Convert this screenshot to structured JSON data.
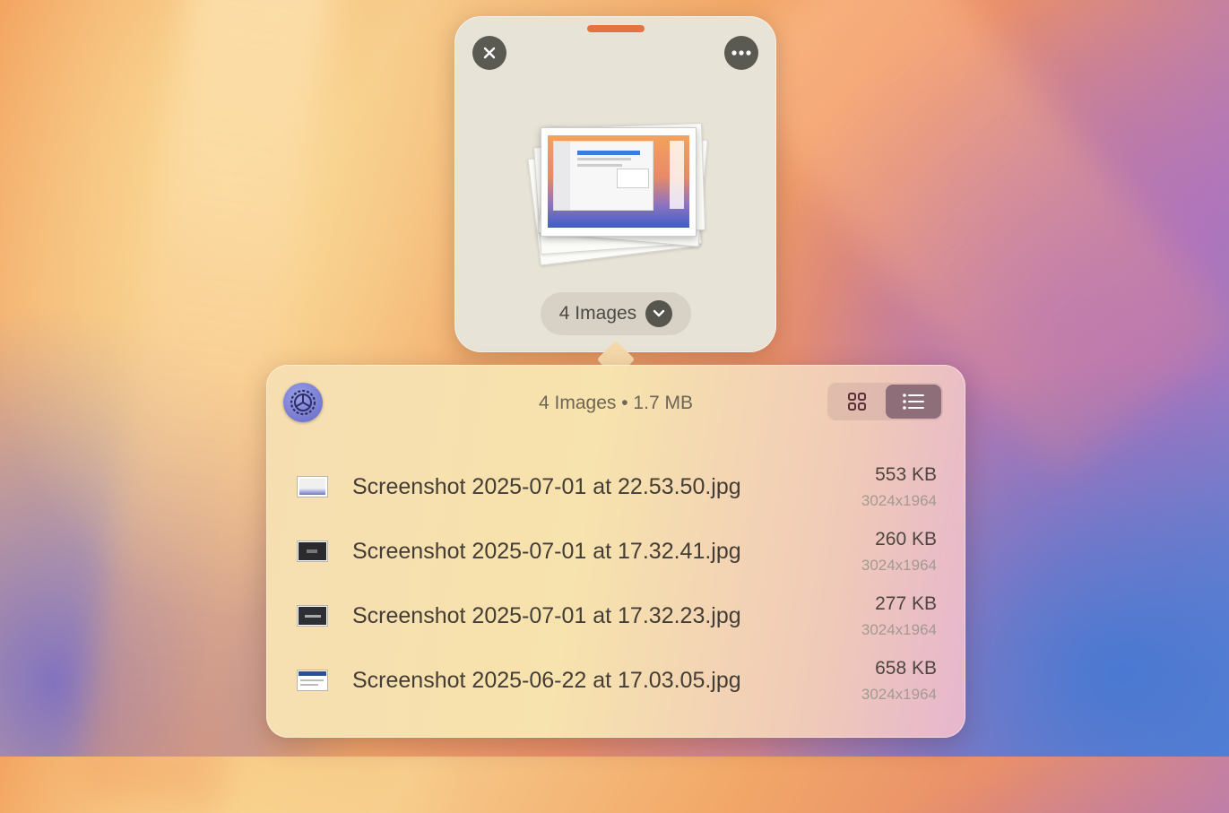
{
  "drop_card": {
    "count_label": "4 Images"
  },
  "panel": {
    "summary": "4 Images • 1.7 MB",
    "files": [
      {
        "name": "Screenshot 2025-07-01 at 22.53.50.jpg",
        "size": "553 KB",
        "dimensions": "3024x1964",
        "thumb_style": "light"
      },
      {
        "name": "Screenshot 2025-07-01 at 17.32.41.jpg",
        "size": "260 KB",
        "dimensions": "3024x1964",
        "thumb_style": "dark"
      },
      {
        "name": "Screenshot 2025-07-01 at 17.32.23.jpg",
        "size": "277 KB",
        "dimensions": "3024x1964",
        "thumb_style": "dark"
      },
      {
        "name": "Screenshot 2025-06-22 at 17.03.05.jpg",
        "size": "658 KB",
        "dimensions": "3024x1964",
        "thumb_style": "document"
      }
    ],
    "view_mode": "list"
  },
  "colors": {
    "accent_handle": "#e4733f",
    "toggle_active": "#8e6f79",
    "circle_button": "#5b5a52"
  },
  "icons": [
    "close-icon",
    "more-icon",
    "chevron-down-icon",
    "grid-view-icon",
    "list-view-icon",
    "app-icon"
  ]
}
